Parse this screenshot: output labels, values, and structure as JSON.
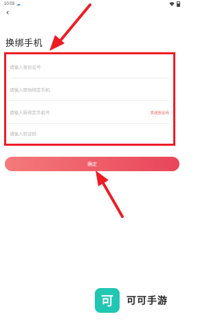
{
  "status_bar": {
    "time": "10:03",
    "notification_icon": "cloud-icon"
  },
  "header": {
    "back_icon": "chevron-left-icon",
    "title": "换绑手机"
  },
  "form": {
    "id_number": {
      "value": "",
      "placeholder": "请输入身份证号"
    },
    "old_phone": {
      "value": "",
      "placeholder": "请输入原始绑定手机"
    },
    "new_phone": {
      "value": "",
      "placeholder": "请输入新绑定手机号",
      "send_code_label": "发送验证码"
    },
    "code": {
      "value": "",
      "placeholder": "请输入验证码"
    }
  },
  "confirm_label": "确定",
  "watermark": {
    "logo_glyph": "可",
    "brand": "可可手游"
  },
  "colors": {
    "accent_red": "#ee1c25",
    "button_gradient_start": "#f47a7a",
    "button_gradient_end": "#e9455a",
    "send_code": "#ee5a5a",
    "logo_bg": "#21c7b3"
  }
}
